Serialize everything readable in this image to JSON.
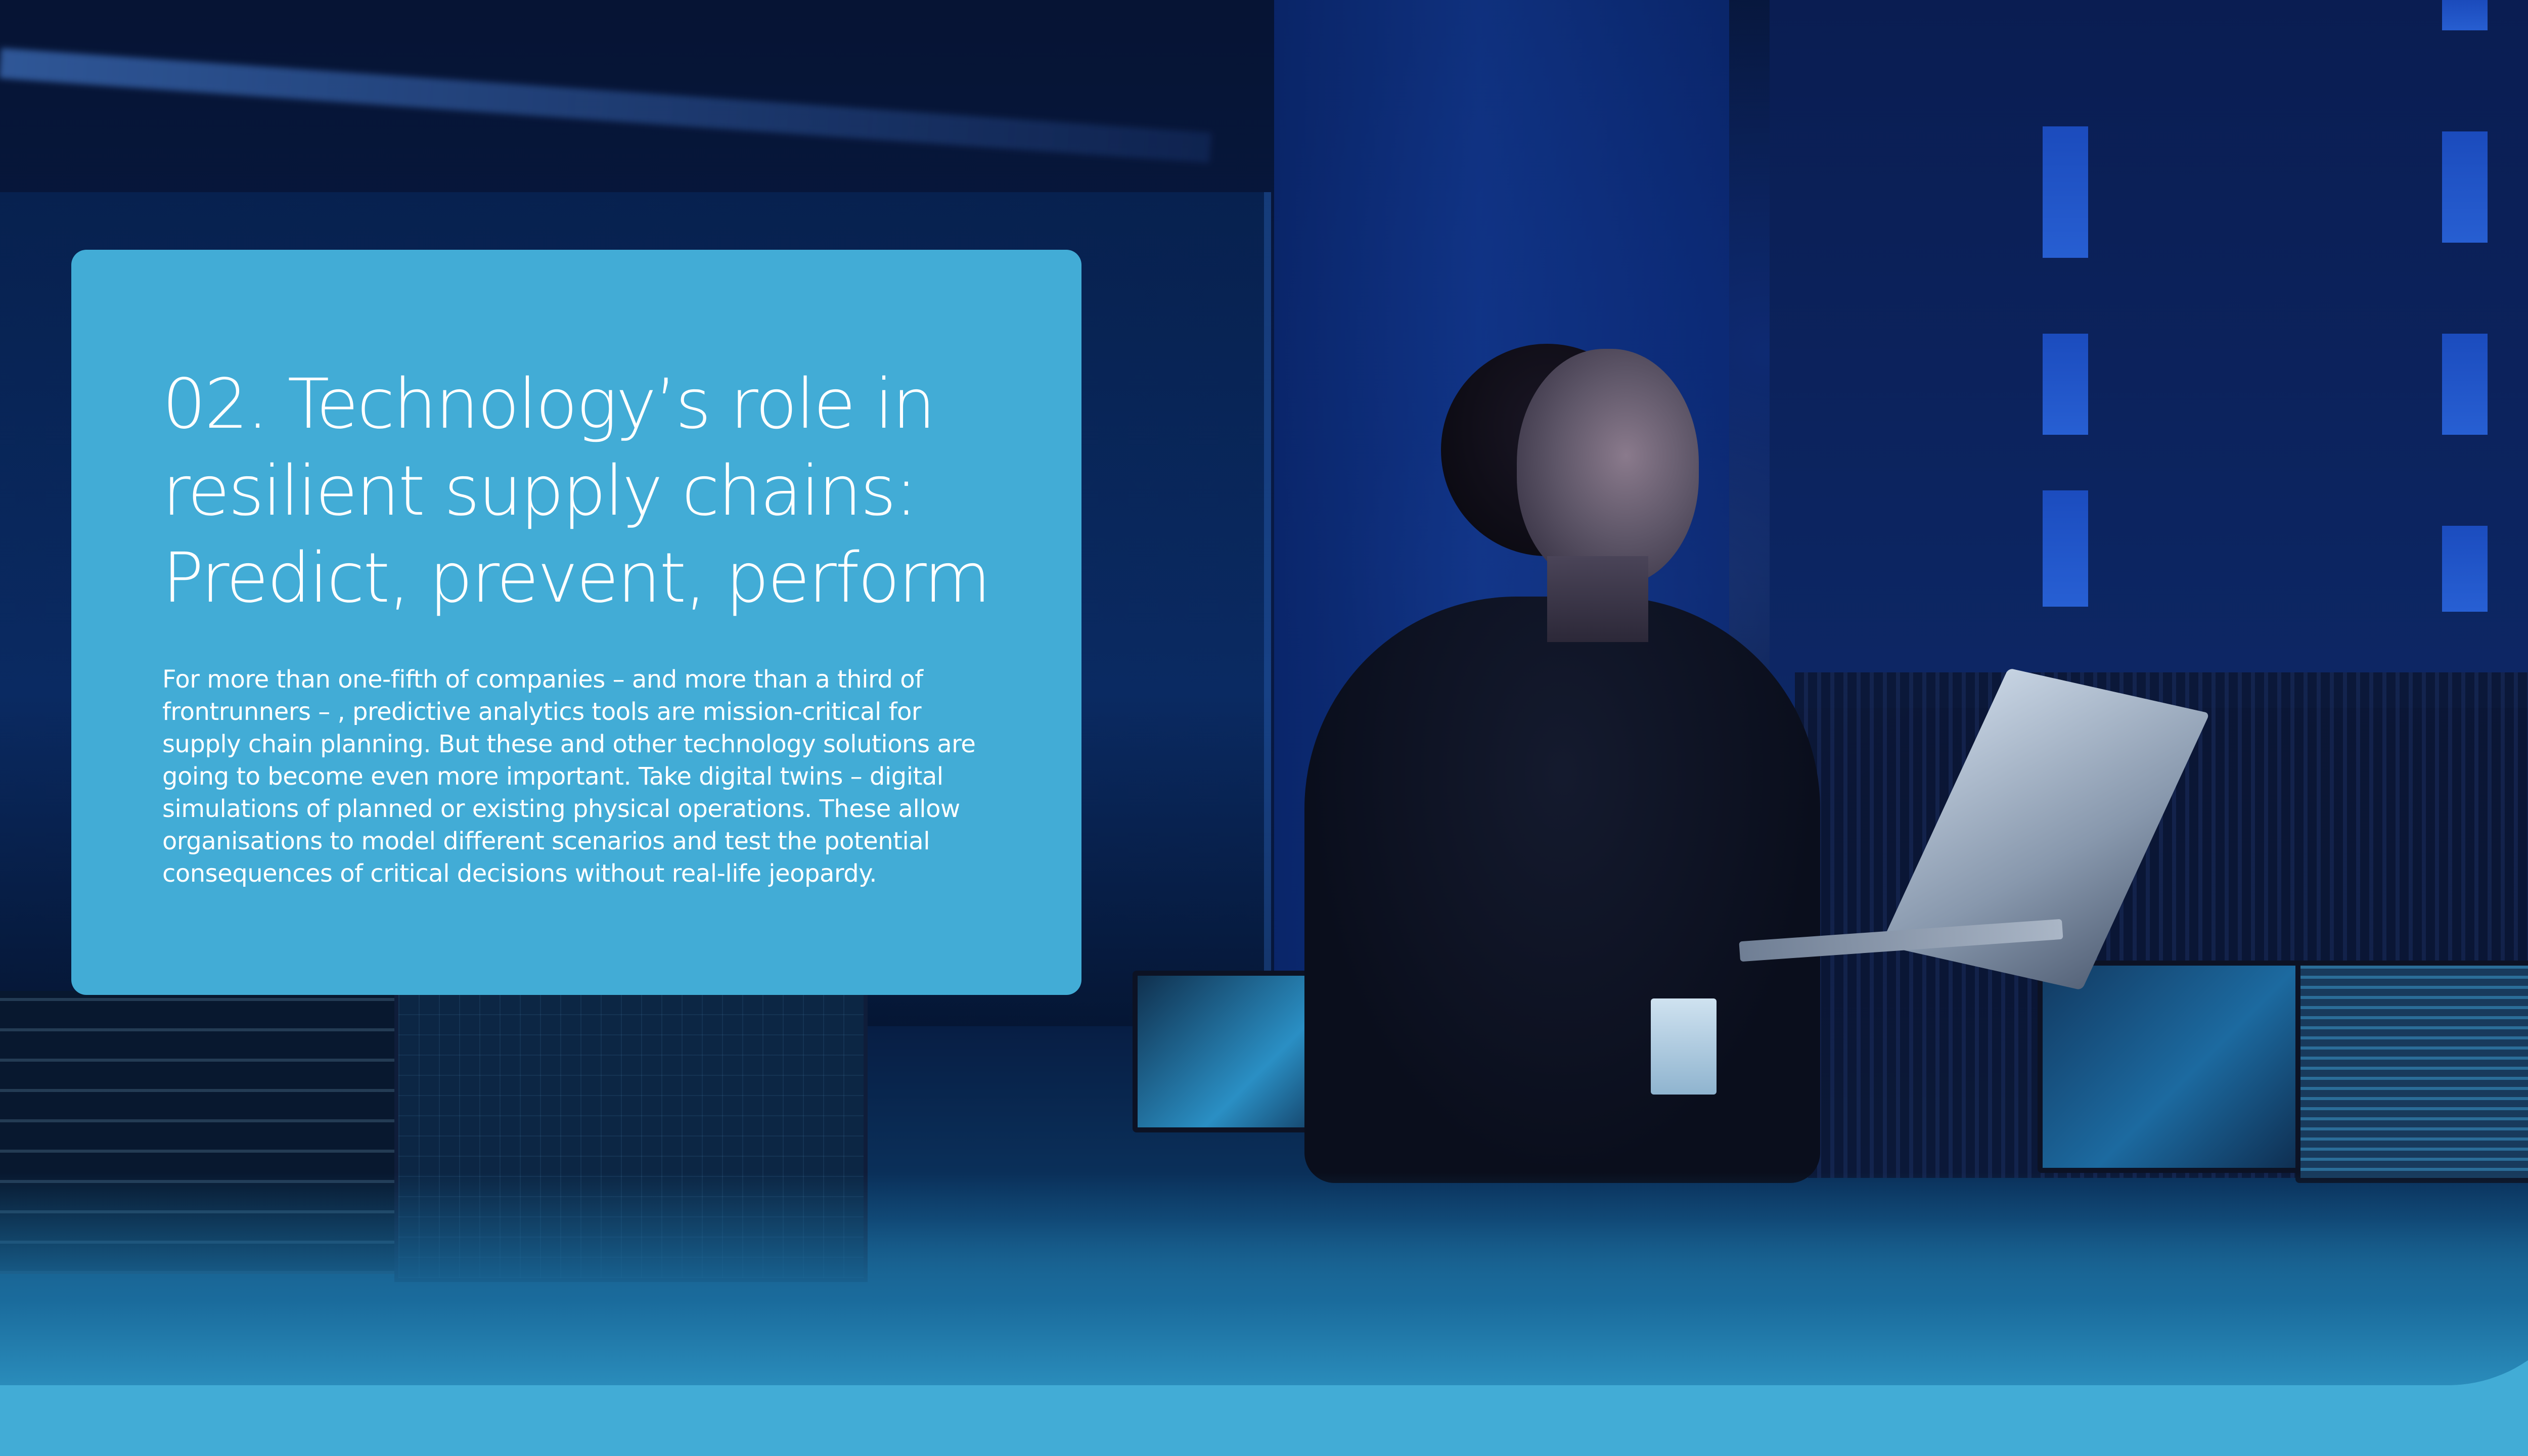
{
  "section": {
    "title_lines": [
      "02. Technology’s role in",
      "resilient supply chains:",
      "Predict, prevent, perform"
    ],
    "body": "For more than one-fifth of companies – and more than a third of frontrunners – , predictive analytics tools are mission-critical for supply chain planning. But these and other technology solutions are going to become even more important. Take digital twins – digital simulations of planned or existing physical operations. These allow organisations to model different scenarios and test the potential consequences of critical decisions without real-life jeopardy."
  },
  "colors": {
    "accent": "#42acd6",
    "text": "#ffffff",
    "hero_dark": "#061434"
  }
}
